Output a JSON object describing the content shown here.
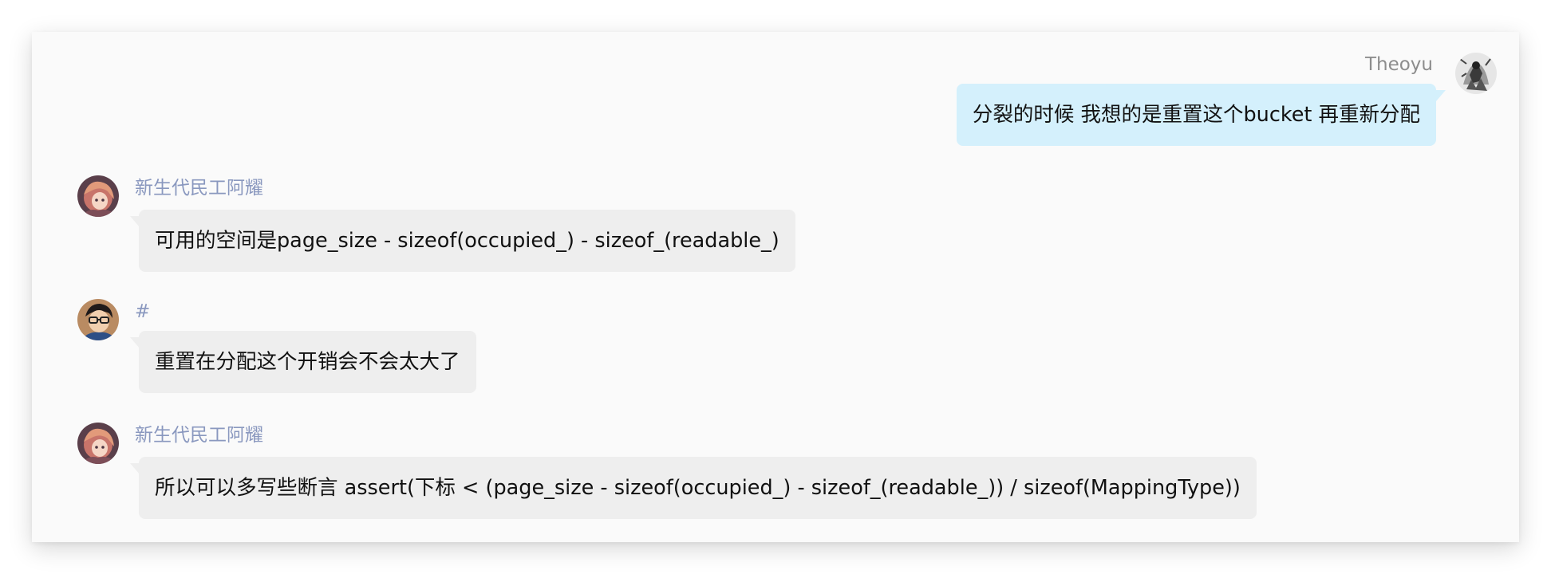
{
  "messages": [
    {
      "sender": "Theoyu",
      "text": "分裂的时候 我想的是重置这个bucket 再重新分配",
      "avatar_icon": "user-avatar-ink-sketch"
    },
    {
      "sender": "新生代民工阿耀",
      "text": "可用的空间是page_size - sizeof(occupied_) - sizeof_(readable_)",
      "avatar_icon": "user-avatar-anime-girl"
    },
    {
      "sender": "#",
      "text": "重置在分配这个开销会不会太大了",
      "avatar_icon": "user-avatar-glasses-boy"
    },
    {
      "sender": "新生代民工阿耀",
      "text": "所以可以多写些断言 assert(下标 < (page_size - sizeof(occupied_) - sizeof_(readable_)) / sizeof(MappingType))",
      "avatar_icon": "user-avatar-anime-girl"
    }
  ],
  "colors": {
    "incoming_bubble": "#eeeeee",
    "outgoing_bubble": "#d4f0fc",
    "incoming_name": "#8a98bf",
    "outgoing_name": "#8d8d8d",
    "panel_background": "#fafafa"
  }
}
